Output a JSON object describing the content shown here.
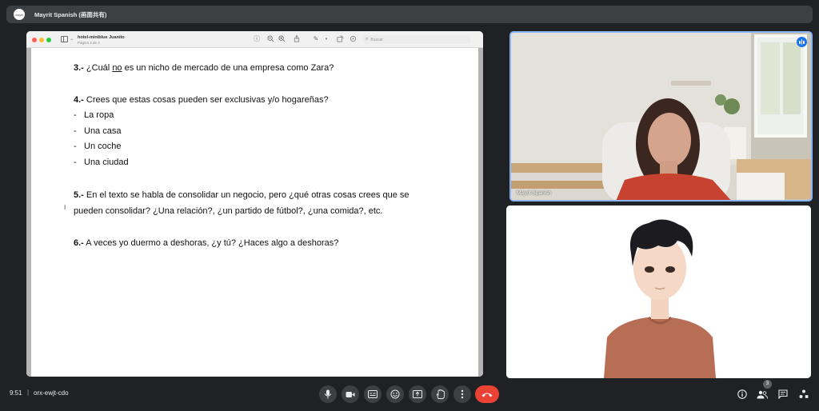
{
  "presenter_bar": {
    "title": "Mayrit Spanish (画面共有)",
    "avatar_text": "mayrit"
  },
  "document": {
    "file_name": "hotel-miniblue Juanito",
    "page_label": "Página 4 de 4",
    "search_placeholder": "Buscar",
    "questions": [
      {
        "number": "3.-",
        "text_before": " ¿Cuál ",
        "underlined": "no",
        "text_after": " es un nicho de mercado de una empresa como Zara?"
      },
      {
        "number": "4.-",
        "text": " Crees que estas cosas pueden ser exclusivas y/o hogareñas?"
      },
      {
        "number": "5.-",
        "text_line1": " En el texto se habla de consolidar un negocio, pero ¿qué otras cosas crees que se",
        "text_line2": "pueden consolidar? ¿Una relación?, ¿un partido de fútbol?, ¿una comida?, etc."
      },
      {
        "number": "6.-",
        "text": " A veces yo duermo a deshoras, ¿y tú? ¿Haces algo a deshoras?"
      }
    ],
    "bullets": [
      {
        "dash": "-",
        "text": "La ropa"
      },
      {
        "dash": "-",
        "text": "Una casa"
      },
      {
        "dash": "-",
        "text": "Un coche"
      },
      {
        "dash": "-",
        "text": "Una ciudad"
      }
    ]
  },
  "tiles": {
    "teacher_name": "Mayrit Spanish"
  },
  "bottom_bar": {
    "time": "9:51",
    "separator": "|",
    "meeting_code": "orx-ewjt-cdo",
    "participants_count": "3"
  },
  "colors": {
    "end_call": "#ea4335",
    "active_speaker_border": "#8ab4f8",
    "speaking_indicator": "#1a73e8"
  }
}
